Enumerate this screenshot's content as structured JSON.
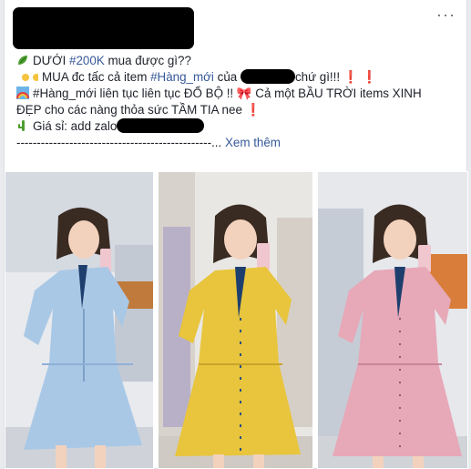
{
  "post": {
    "more_icon": "···",
    "lines": {
      "l1_pre": "DƯỚI ",
      "l1_tag": "#200K",
      "l1_post": " mua được gì??",
      "l2_pre": "MUA đc tấc cả item ",
      "l2_tag": "#Hàng_mới",
      "l2_mid": " của ",
      "l2_post": "chứ gì!!!",
      "l3a": "#Hàng_mới liên tục liên tục ĐỔ BỘ !! ",
      "l3b": "Cả một BẦU TRỜI items XINH",
      "l4": "ĐẸP cho các nàng thỏa sức TẦM TIA nee",
      "l5": "Giá sỉ: add zalo",
      "l6_dashes": "------------------------------------------------...",
      "see_more": "Xem thêm"
    },
    "icons": [
      "leaf-icon",
      "pointing-hands-icon",
      "exclamation-icon",
      "rainbow-icon",
      "ribbon-icon",
      "cactus-icon"
    ]
  },
  "photos": [
    {
      "name": "blue-dress-photo",
      "dress_color": "#a9c8e6"
    },
    {
      "name": "yellow-dress-photo",
      "dress_color": "#e8c53c"
    },
    {
      "name": "pink-dress-photo",
      "dress_color": "#e7a8b8"
    }
  ]
}
